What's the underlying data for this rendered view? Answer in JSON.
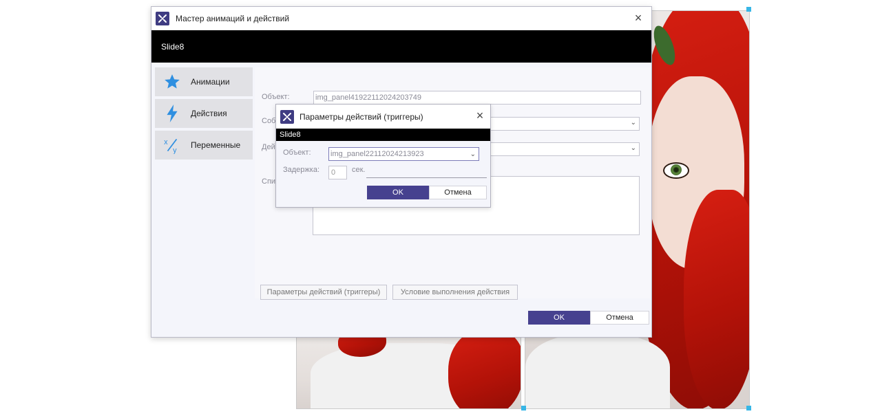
{
  "main_dialog": {
    "title": "Мастер анимаций и действий",
    "slide_name": "Slide8",
    "sidebar": [
      {
        "label": "Анимации",
        "icon": "star-icon"
      },
      {
        "label": "Действия",
        "icon": "lightning-icon"
      },
      {
        "label": "Переменные",
        "icon": "variables-icon"
      }
    ],
    "object_label": "Объект:",
    "object_value": "img_panel41922112024203749",
    "event_label_visible": "Собы",
    "action_label_visible": "Дей",
    "list_label_visible": "Спис",
    "trigger_params_button": "Параметры действий (триггеры)",
    "condition_button": "Условие выполнения действия",
    "ok": "OK",
    "cancel": "Отмена"
  },
  "trigger_dialog": {
    "title": "Параметры действий (триггеры)",
    "slide_name": "Slide8",
    "object_label": "Объект:",
    "object_value": "img_panel22112024213923",
    "delay_label": "Задержка:",
    "delay_value": "0",
    "delay_unit": "сек.",
    "ok": "OK",
    "cancel": "Отмена"
  },
  "colors": {
    "accent": "#46418f",
    "icon_blue": "#2f8fe0",
    "slide_bar": "#000000"
  }
}
